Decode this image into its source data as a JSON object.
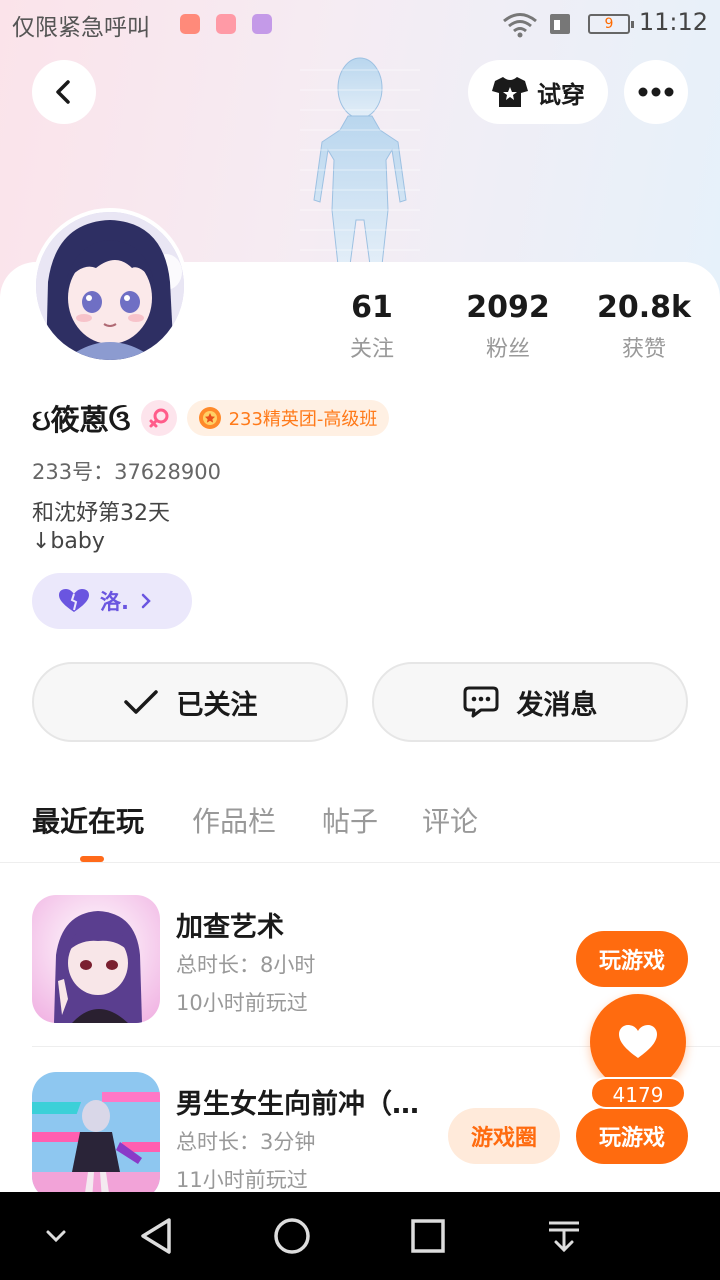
{
  "status_bar": {
    "carrier": "仅限紧急呼叫",
    "battery": "9",
    "time": "11:12"
  },
  "header": {
    "tryon_label": "试穿"
  },
  "profile": {
    "name": "ઇ筱蒽ઉ",
    "badge": "233精英团-高级班",
    "uid": "233号：37628900",
    "bio_line1": "和沈妤第32天",
    "bio_line2": "↓baby",
    "cp_tag": "洛."
  },
  "stats": [
    {
      "num": "61",
      "label": "关注"
    },
    {
      "num": "2092",
      "label": "粉丝"
    },
    {
      "num": "20.8k",
      "label": "获赞"
    }
  ],
  "actions": {
    "follow": "已关注",
    "message": "发消息"
  },
  "tabs": [
    "最近在玩",
    "作品栏",
    "帖子",
    "评论"
  ],
  "games": [
    {
      "title": "加查艺术",
      "duration": "总时长：8小时",
      "last_played": "10小时前玩过",
      "play_label": "玩游戏"
    },
    {
      "title": "男生女生向前冲（…",
      "duration": "总时长：3分钟",
      "last_played": "11小时前玩过",
      "play_label": "玩游戏",
      "circle_label": "游戏圈"
    }
  ],
  "like_fab": {
    "count": "4179"
  },
  "icons": {
    "back": "chevron-left-icon",
    "more": "more-dots-icon",
    "shirt": "shirt-icon",
    "gender": "female-icon",
    "heart": "heart-icon"
  },
  "colors": {
    "accent": "#ff6b0f",
    "cp_purple": "#6a55e0"
  }
}
